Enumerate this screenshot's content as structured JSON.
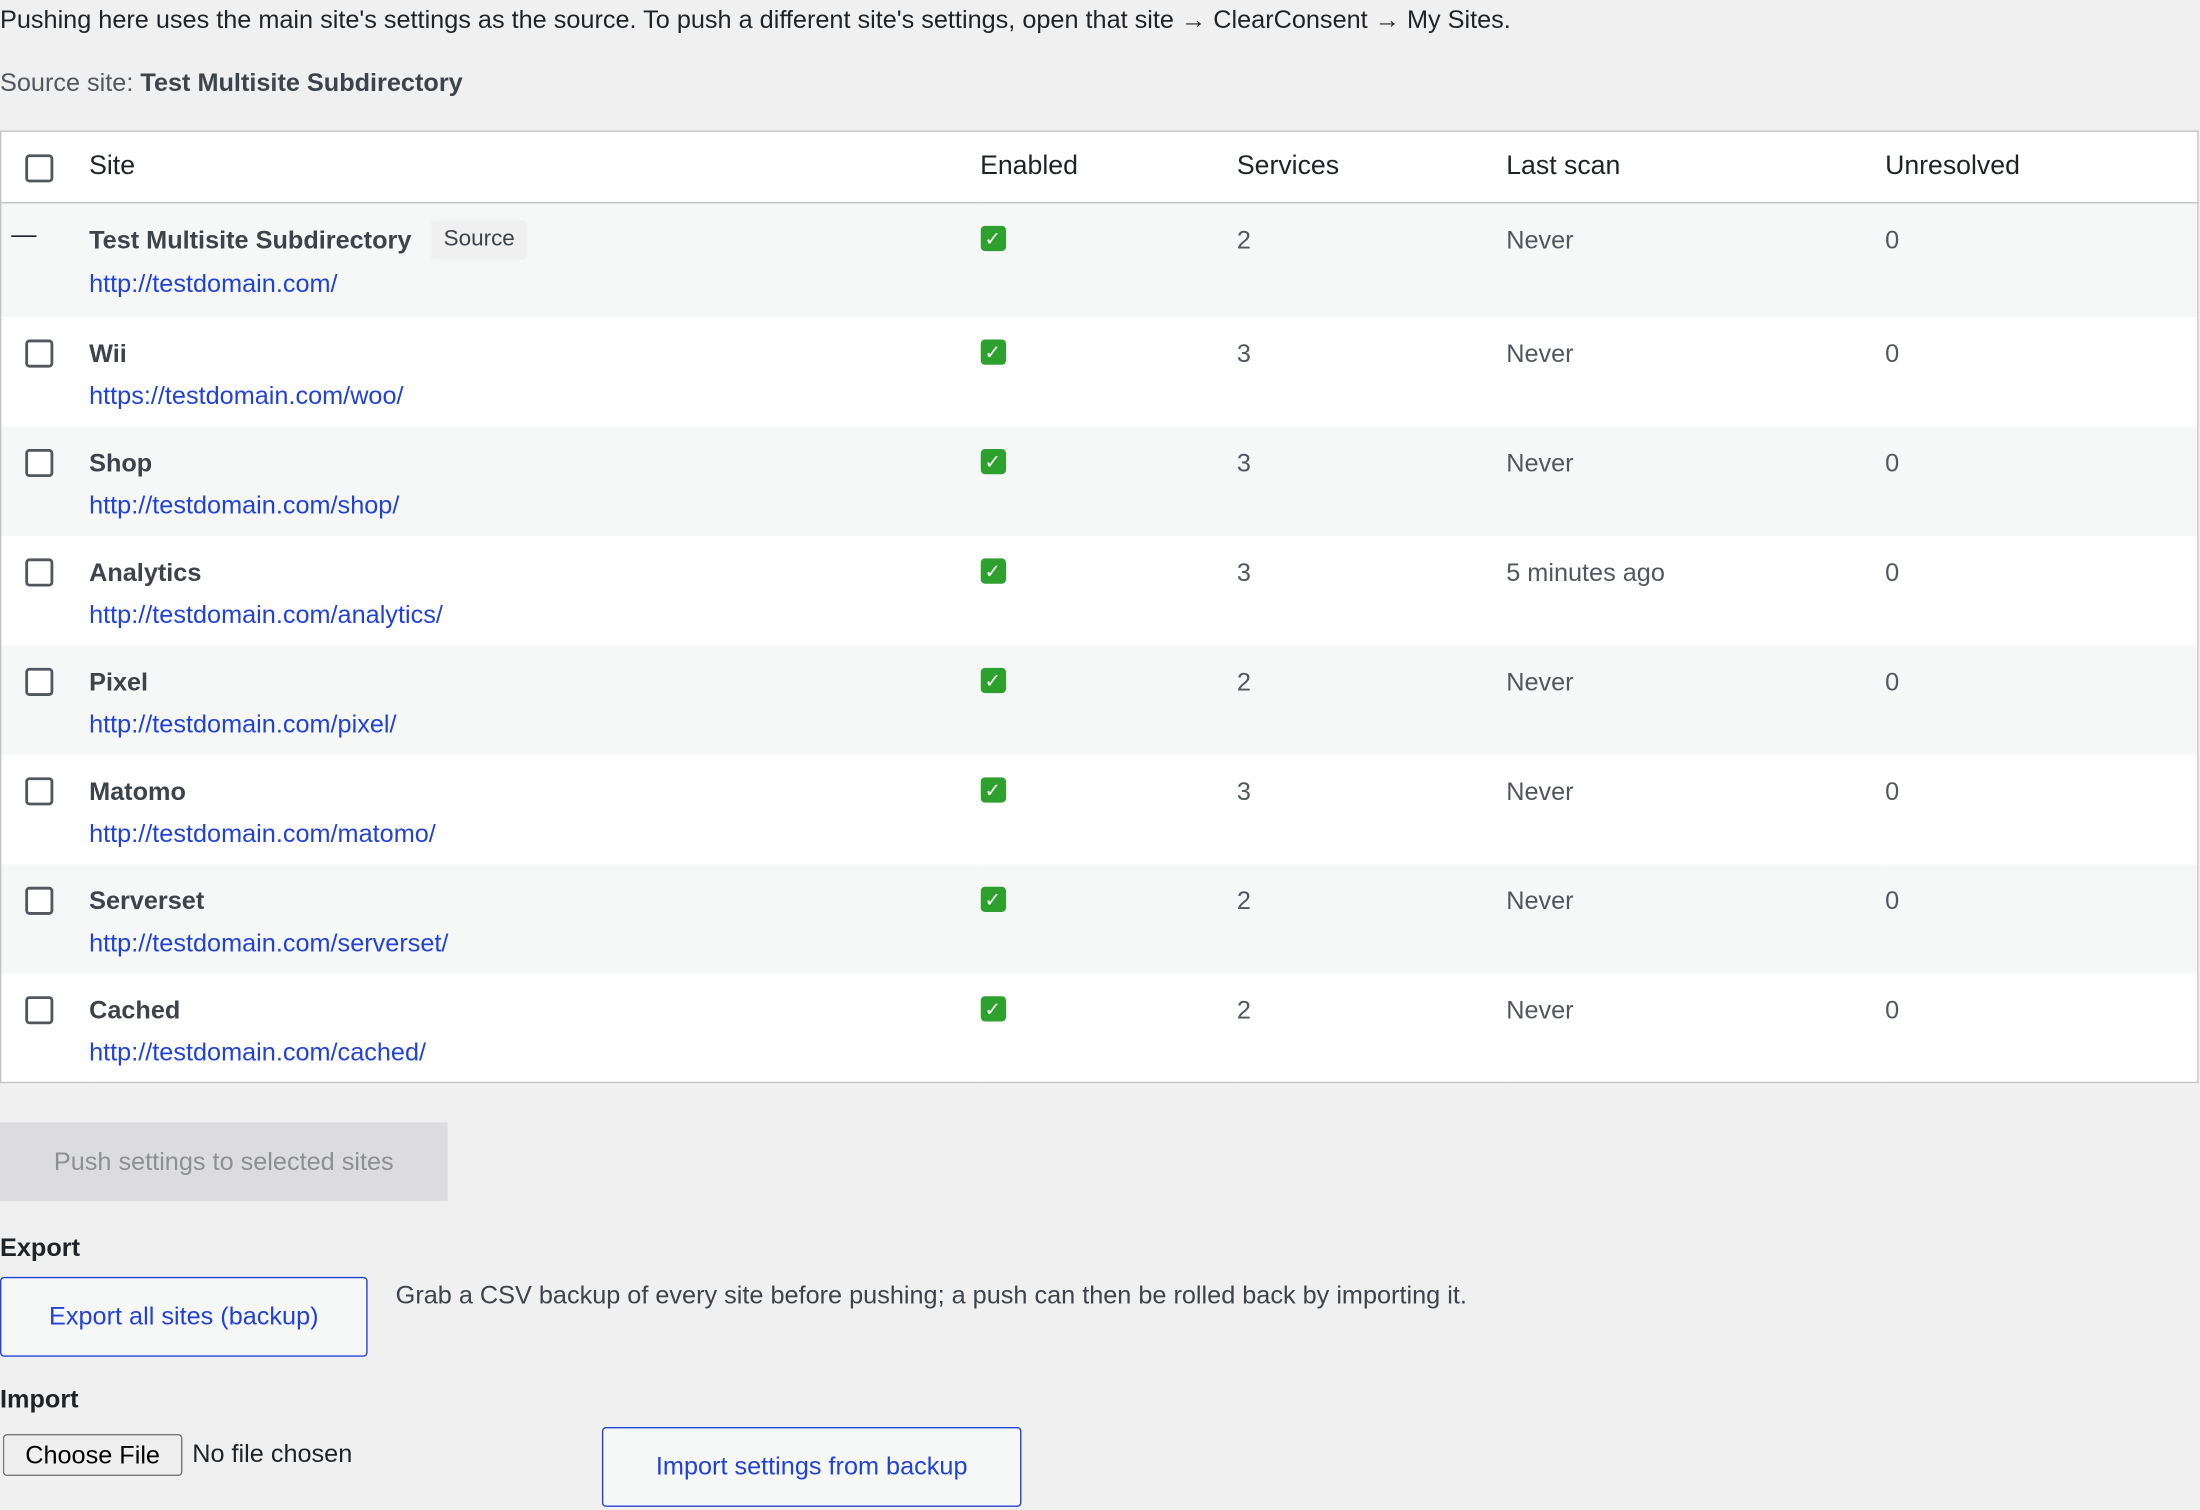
{
  "intro": "Pushing here uses the main site's settings as the source. To push a different site's settings, open that site → ClearConsent → My Sites.",
  "source": {
    "label": "Source site:",
    "name": "Test Multisite Subdirectory"
  },
  "table": {
    "headers": {
      "site": "Site",
      "enabled": "Enabled",
      "services": "Services",
      "last_scan": "Last scan",
      "unresolved": "Unresolved"
    },
    "source_badge": "Source",
    "enabled_icon": "check-mark-icon",
    "rows": [
      {
        "name": "Test Multisite Subdirectory",
        "url": "http://testdomain.com/",
        "enabled": true,
        "services": "2",
        "last_scan": "Never",
        "unresolved": "0",
        "is_source": true
      },
      {
        "name": "Wii",
        "url": "https://testdomain.com/woo/",
        "enabled": true,
        "services": "3",
        "last_scan": "Never",
        "unresolved": "0"
      },
      {
        "name": "Shop",
        "url": "http://testdomain.com/shop/",
        "enabled": true,
        "services": "3",
        "last_scan": "Never",
        "unresolved": "0"
      },
      {
        "name": "Analytics",
        "url": "http://testdomain.com/analytics/",
        "enabled": true,
        "services": "3",
        "last_scan": "5 minutes ago",
        "unresolved": "0"
      },
      {
        "name": "Pixel",
        "url": "http://testdomain.com/pixel/",
        "enabled": true,
        "services": "2",
        "last_scan": "Never",
        "unresolved": "0"
      },
      {
        "name": "Matomo",
        "url": "http://testdomain.com/matomo/",
        "enabled": true,
        "services": "3",
        "last_scan": "Never",
        "unresolved": "0"
      },
      {
        "name": "Serverset",
        "url": "http://testdomain.com/serverset/",
        "enabled": true,
        "services": "2",
        "last_scan": "Never",
        "unresolved": "0"
      },
      {
        "name": "Cached",
        "url": "http://testdomain.com/cached/",
        "enabled": true,
        "services": "2",
        "last_scan": "Never",
        "unresolved": "0"
      }
    ]
  },
  "push_button": "Push settings to selected sites",
  "export": {
    "heading": "Export",
    "button": "Export all sites (backup)",
    "description": "Grab a CSV backup of every site before pushing; a push can then be rolled back by importing it."
  },
  "import": {
    "heading": "Import",
    "choose_file": "Choose File",
    "file_status": "No file chosen",
    "button": "Import settings from backup"
  },
  "colors": {
    "link": "#2242d6",
    "check": "#2ea02e",
    "background": "#f0f0f1"
  }
}
